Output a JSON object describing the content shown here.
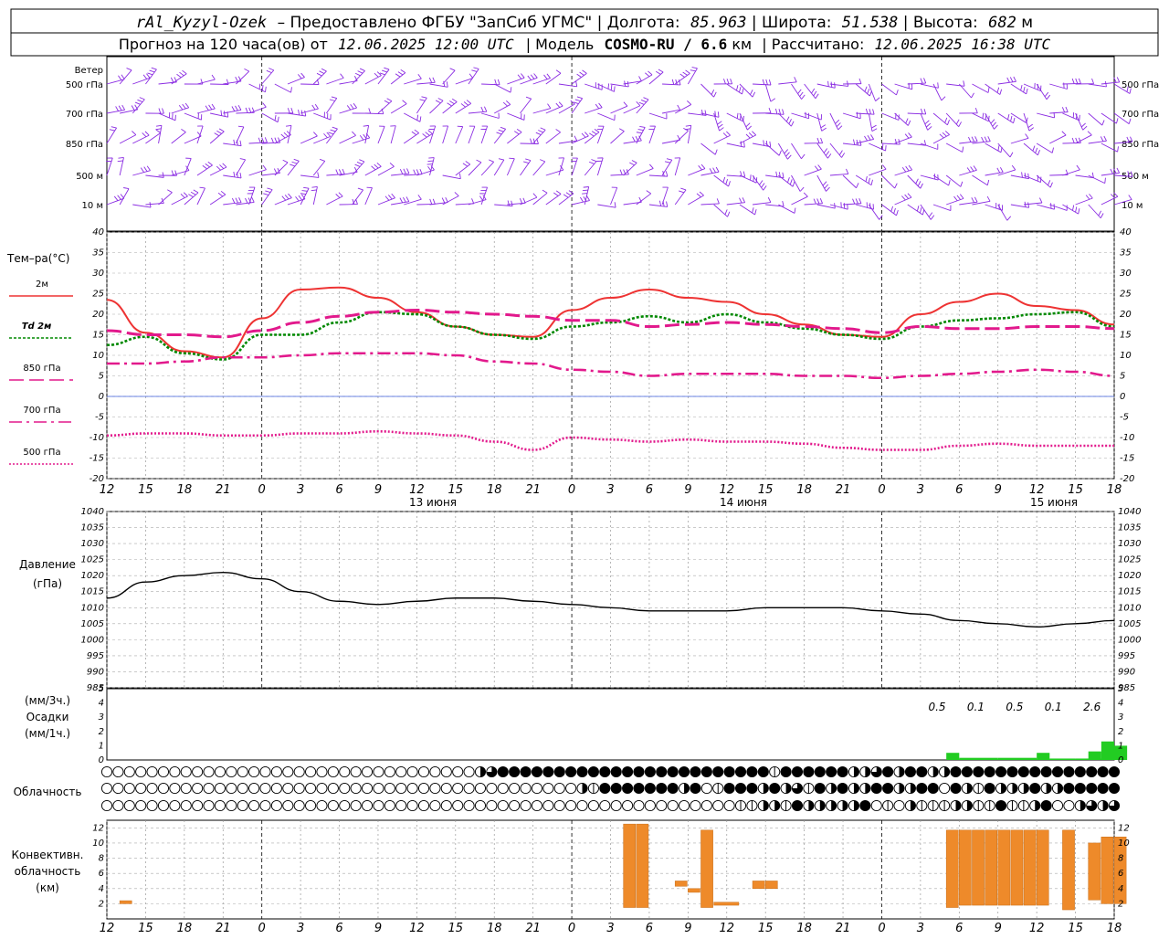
{
  "header": {
    "station": "rAl_Kyzyl-Ozek",
    "provider": "– Предоставлено ФГБУ \"ЗапСиб УГМС\"",
    "lon_label": "Долгота:",
    "lon": "85.963",
    "lat_label": "Широта:",
    "lat": "51.538",
    "alt_label": "Высота:",
    "alt": "682",
    "alt_unit": "м",
    "forecast_label": "Прогноз на 120 часа(ов) от",
    "forecast_from": "12.06.2025 12:00 UTC",
    "model_label": "| Модель",
    "model": "COSMO-RU / 6.6",
    "model_unit": "км",
    "calc_label": "| Рассчитано:",
    "calc_time": "12.06.2025 16:38 UTC"
  },
  "labels": {
    "wind": "Ветер",
    "wind_levels": [
      "500 гПа",
      "700 гПа",
      "850 гПа",
      "500 м",
      "10  м"
    ],
    "temp": "Тем–ра(°C)",
    "temp_legend": [
      "2м",
      "Td  2м",
      "850 гПа",
      "700 гПа",
      "500 гПа"
    ],
    "pressure": "Давление",
    "pressure_unit": "(гПа)",
    "precip_top": "(мм/3ч.)",
    "precip": "Осадки",
    "precip_bottom": "(мм/1ч.)",
    "cloud": "Облачность",
    "conv": [
      "Конвективн.",
      "облачность",
      "(км)"
    ]
  },
  "x_axis": {
    "ticks": [
      "12",
      "15",
      "18",
      "21",
      "0",
      "3",
      "6",
      "9",
      "12",
      "15",
      "18",
      "21",
      "0",
      "3",
      "6",
      "9",
      "12",
      "15",
      "18",
      "21",
      "0",
      "3",
      "6",
      "9",
      "12",
      "15",
      "18"
    ],
    "days": [
      "13 июня",
      "14 июня",
      "15 июня"
    ]
  },
  "chart_data": [
    {
      "type": "line",
      "title": "Тем–ра(°C)",
      "ylim": [
        -20,
        40
      ],
      "y_ticks": [
        40,
        35,
        30,
        25,
        20,
        15,
        10,
        5,
        0,
        -5,
        -10,
        -15,
        -20
      ],
      "x": [
        0,
        3,
        6,
        9,
        12,
        15,
        18,
        21,
        24,
        27,
        30,
        33,
        36,
        39,
        42,
        45,
        48,
        51,
        54,
        57,
        60,
        63,
        66,
        69,
        72,
        75,
        78
      ],
      "series": [
        {
          "name": "2м",
          "color": "#ee3333",
          "values": [
            23.5,
            15.5,
            11,
            9.5,
            19,
            26,
            26.5,
            24,
            20.5,
            17,
            15,
            14.5,
            21,
            24,
            26,
            24,
            23,
            20,
            17.5,
            15,
            14.5,
            20,
            23,
            25,
            22,
            21,
            17.5
          ]
        },
        {
          "name": "Td  2м",
          "color": "#008800",
          "values": [
            12.5,
            14.5,
            10.5,
            9,
            15,
            15,
            18,
            20.5,
            20,
            17,
            15,
            14,
            17,
            18,
            19.5,
            18,
            20,
            18,
            16.5,
            15,
            14,
            17,
            18.5,
            19,
            20,
            20.5,
            17
          ]
        },
        {
          "name": "850 гПа",
          "color": "#e2198c",
          "values": [
            16,
            15,
            15,
            14.5,
            16,
            18,
            19.5,
            20.5,
            21,
            20.5,
            20,
            19.5,
            18.5,
            18.5,
            17,
            17.5,
            18,
            17.5,
            17,
            16.5,
            15.5,
            17,
            16.5,
            16.5,
            17,
            17,
            16.5
          ]
        },
        {
          "name": "700 гПа",
          "color": "#e2198c",
          "values": [
            8,
            8,
            8.5,
            9.5,
            9.5,
            10,
            10.5,
            10.5,
            10.5,
            10,
            8.5,
            8,
            6.5,
            6,
            5,
            5.5,
            5.5,
            5.5,
            5,
            5,
            4.5,
            5,
            5.5,
            6,
            6.5,
            6,
            5
          ]
        },
        {
          "name": "500 гПа",
          "color": "#e2198c",
          "values": [
            -9.5,
            -9,
            -9,
            -9.5,
            -9.5,
            -9,
            -9,
            -8.5,
            -9,
            -9.5,
            -11,
            -13,
            -10,
            -10.5,
            -11,
            -10.5,
            -11,
            -11,
            -11.5,
            -12.5,
            -13,
            -13,
            -12,
            -11.5,
            -12,
            -12,
            -12
          ]
        }
      ]
    },
    {
      "type": "line",
      "title": "Давление",
      "ylabel": "(гПа)",
      "ylim": [
        985,
        1040
      ],
      "y_ticks": [
        1040,
        1035,
        1030,
        1025,
        1020,
        1015,
        1010,
        1005,
        1000,
        995,
        990,
        985
      ],
      "x": [
        0,
        3,
        6,
        9,
        12,
        15,
        18,
        21,
        24,
        27,
        30,
        33,
        36,
        39,
        42,
        45,
        48,
        51,
        54,
        57,
        60,
        63,
        66,
        69,
        72,
        75,
        78
      ],
      "series": [
        {
          "name": "Давление",
          "color": "#000000",
          "values": [
            1013,
            1018,
            1020,
            1021,
            1019,
            1015,
            1012,
            1011,
            1012,
            1013,
            1013,
            1012,
            1011,
            1010,
            1009,
            1009,
            1009,
            1010,
            1010,
            1010,
            1009,
            1008,
            1006,
            1005,
            1004,
            1005,
            1006
          ]
        }
      ]
    },
    {
      "type": "bar",
      "title": "Осадки",
      "ylim": [
        0,
        5
      ],
      "y_ticks": [
        5,
        4,
        3,
        2,
        1,
        0
      ],
      "values_hourly": [
        {
          "x": 65,
          "w": 1,
          "v": 0.5
        },
        {
          "x": 66,
          "w": 3,
          "v": 0.15
        },
        {
          "x": 69,
          "w": 3,
          "v": 0.15
        },
        {
          "x": 72,
          "w": 1,
          "v": 0.5
        },
        {
          "x": 73,
          "w": 2,
          "v": 0.1
        },
        {
          "x": 75,
          "w": 2,
          "v": 0.1
        },
        {
          "x": 76,
          "w": 1,
          "v": 0.6
        },
        {
          "x": 77,
          "w": 1,
          "v": 1.3
        },
        {
          "x": 78,
          "w": 1,
          "v": 1.0
        }
      ],
      "annotations": [
        {
          "x": 64,
          "text": "0.5"
        },
        {
          "x": 67,
          "text": "0.1"
        },
        {
          "x": 70,
          "text": "0.5"
        },
        {
          "x": 73,
          "text": "0.1"
        },
        {
          "x": 76,
          "text": "2.6"
        }
      ]
    },
    {
      "type": "bar",
      "title": "Конвективн. облачность (км)",
      "ylim": [
        0,
        13
      ],
      "y_ticks": [
        12,
        10,
        8,
        6,
        4,
        2
      ],
      "bars": [
        {
          "x": 1,
          "w": 1,
          "base": 2.0,
          "top": 2.4
        },
        {
          "x": 40,
          "w": 1,
          "base": 1.5,
          "top": 12.5
        },
        {
          "x": 41,
          "w": 1,
          "base": 1.5,
          "top": 12.5
        },
        {
          "x": 44,
          "w": 1,
          "base": 4.3,
          "top": 5.0
        },
        {
          "x": 45,
          "w": 1,
          "base": 3.5,
          "top": 4.0
        },
        {
          "x": 46,
          "w": 1,
          "base": 1.5,
          "top": 11.7
        },
        {
          "x": 47,
          "w": 2,
          "base": 1.8,
          "top": 2.2
        },
        {
          "x": 50,
          "w": 1,
          "base": 4.0,
          "top": 5.0
        },
        {
          "x": 51,
          "w": 1,
          "base": 4.0,
          "top": 5.0
        },
        {
          "x": 65,
          "w": 1,
          "base": 1.5,
          "top": 11.7
        },
        {
          "x": 66,
          "w": 1,
          "base": 1.8,
          "top": 11.7
        },
        {
          "x": 67,
          "w": 1,
          "base": 1.8,
          "top": 11.7
        },
        {
          "x": 68,
          "w": 1,
          "base": 1.8,
          "top": 11.7
        },
        {
          "x": 69,
          "w": 1,
          "base": 1.8,
          "top": 11.7
        },
        {
          "x": 70,
          "w": 1,
          "base": 1.8,
          "top": 11.7
        },
        {
          "x": 71,
          "w": 1,
          "base": 1.8,
          "top": 11.7
        },
        {
          "x": 72,
          "w": 1,
          "base": 1.8,
          "top": 11.7
        },
        {
          "x": 74,
          "w": 1,
          "base": 1.2,
          "top": 11.7
        },
        {
          "x": 76,
          "w": 1,
          "base": 2.5,
          "top": 10.0
        },
        {
          "x": 77,
          "w": 1,
          "base": 2.0,
          "top": 10.8
        },
        {
          "x": 78,
          "w": 1,
          "base": 2.0,
          "top": 10.8
        }
      ]
    }
  ],
  "cloud_rows": [
    "000000000000000000000000000000000234444444444444444444444441444444223424422444444444444444",
    "000000000000000000000000000000000000000000214444444240144424231424224422440421422242244444",
    "000000000000000000000000000000000000000000000000000000001122142222240102111221141124002323"
  ],
  "wind": {
    "colors": {
      "upper": "#7a2ad8",
      "barb": "#8a2be2"
    }
  }
}
